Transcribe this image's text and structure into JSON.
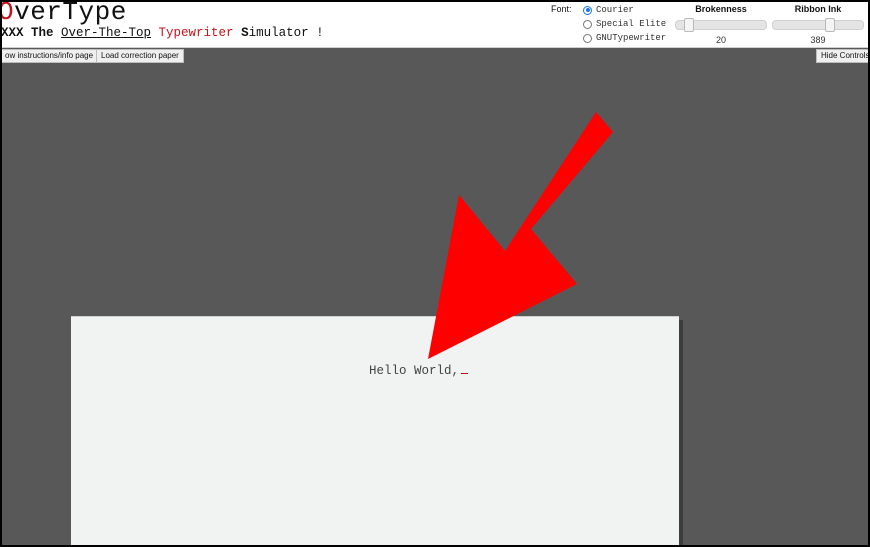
{
  "app": {
    "logo_first": "O",
    "logo_rest": "verType",
    "tagline": {
      "prefix": "XXX The ",
      "over": "Over-The-Top",
      "space1": " ",
      "typewriter": "Typewriter",
      "space2": " ",
      "s": "S",
      "imulator": "imulator !"
    }
  },
  "controls": {
    "font_label": "Font:",
    "fonts": [
      {
        "label": "Courier",
        "selected": true
      },
      {
        "label": "Special Elite",
        "selected": false
      },
      {
        "label": "GNUTypewriter",
        "selected": false
      }
    ],
    "brokenness": {
      "title": "Brokenness",
      "value": "20",
      "fraction": 0.1
    },
    "ribbon_ink": {
      "title": "Ribbon Ink",
      "value": "389",
      "fraction": 0.65
    }
  },
  "toolbar": {
    "instructions_label": "ow instructions/info page",
    "correction_label": "Load correction paper",
    "hide_controls_label": "Hide Controls"
  },
  "paper": {
    "typed_text": "Hello World,"
  },
  "colors": {
    "accent_red": "#c0141b",
    "annotation_arrow": "#ff0000",
    "background": "#585858",
    "paper": "#f1f2f2"
  }
}
